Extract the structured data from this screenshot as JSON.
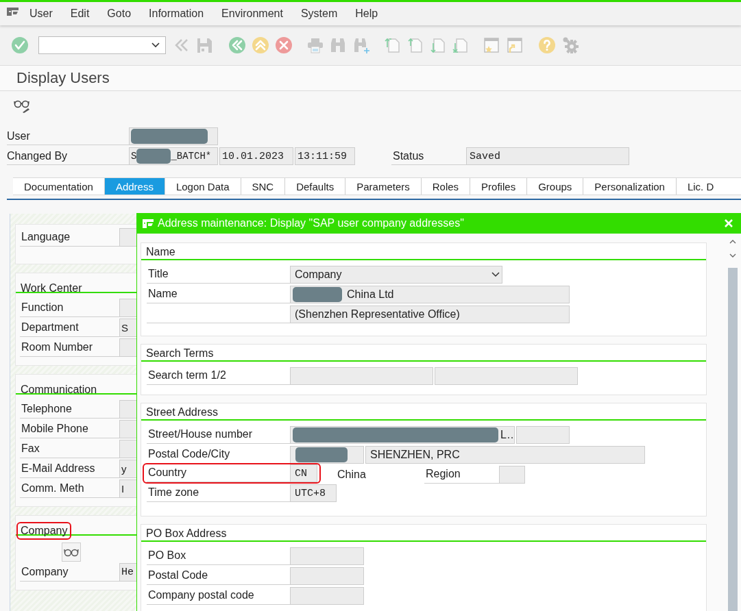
{
  "menu": [
    "User",
    "Edit",
    "Goto",
    "Information",
    "Environment",
    "System",
    "Help"
  ],
  "title": "Display Users",
  "header": {
    "rows": [
      {
        "label": "User",
        "fields": [
          {
            "kind": "user",
            "redacted": true
          }
        ]
      },
      {
        "label": "Changed By",
        "fields": [
          {
            "kind": "user",
            "prefix": "S",
            "redacted": true,
            "text": "_BATCH*"
          },
          {
            "kind": "date",
            "text": "10.01.2023"
          },
          {
            "kind": "time",
            "text": "13:11:59"
          }
        ]
      }
    ],
    "status": {
      "label": "Status",
      "value": "Saved"
    }
  },
  "tabs": [
    {
      "label": "Documentation",
      "selected": false
    },
    {
      "label": "Address",
      "selected": true
    },
    {
      "label": "Logon Data",
      "selected": false
    },
    {
      "label": "SNC",
      "selected": false
    },
    {
      "label": "Defaults",
      "selected": false
    },
    {
      "label": "Parameters",
      "selected": false
    },
    {
      "label": "Roles",
      "selected": false
    },
    {
      "label": "Profiles",
      "selected": false
    },
    {
      "label": "Groups",
      "selected": false
    },
    {
      "label": "Personalization",
      "selected": false
    },
    {
      "label": "Lic. D",
      "selected": false
    }
  ],
  "left_panel": {
    "groups": [
      {
        "rows": [
          {
            "label": "Language"
          }
        ]
      },
      {
        "title": "Work Center",
        "highlighted": false,
        "rows": [
          {
            "label": "Function"
          },
          {
            "label": "Department",
            "value": "S"
          },
          {
            "label": "Room Number"
          }
        ]
      },
      {
        "title": "Communication",
        "highlighted": false,
        "rows": [
          {
            "label": "Telephone"
          },
          {
            "label": "Mobile Phone"
          },
          {
            "label": "Fax"
          },
          {
            "label": "E-Mail Address",
            "value": "y"
          },
          {
            "label": "Comm. Meth",
            "value": "I"
          }
        ]
      },
      {
        "title": "Company",
        "highlighted": true,
        "display_button": true,
        "rows": [
          {
            "label": "Company",
            "value": "He",
            "mono": true
          }
        ]
      }
    ]
  },
  "dialog": {
    "title": "Address maintenance: Display \"SAP user company addresses\"",
    "groups": [
      {
        "title": "Name",
        "rows": [
          {
            "label": "Title",
            "fields": [
              {
                "kind": "dropdown",
                "text": "Company"
              }
            ]
          },
          {
            "label": "Name",
            "fields": [
              {
                "kind": "name",
                "redacted": true,
                "text": "China Ltd"
              }
            ]
          },
          {
            "fields": [
              {
                "kind": "name",
                "text": "(Shenzhen Representative Office)"
              }
            ]
          }
        ]
      },
      {
        "title": "Search Terms",
        "rows": [
          {
            "label": "Search term 1/2",
            "fields": [
              {
                "kind": "search"
              },
              {
                "kind": "search"
              }
            ]
          }
        ]
      },
      {
        "title": "Street Address",
        "rows": [
          {
            "label": "Street/House number",
            "fields": [
              {
                "kind": "street",
                "redacted": true,
                "text": "L…"
              },
              {
                "kind": "house"
              }
            ]
          },
          {
            "label": "Postal Code/City",
            "fields": [
              {
                "kind": "postal",
                "redacted": true
              },
              {
                "kind": "city",
                "text": "SHENZHEN, PRC"
              }
            ]
          },
          {
            "label": "Country",
            "highlighted": true,
            "fields": [
              {
                "kind": "country",
                "text": "CN"
              }
            ],
            "description": "China",
            "extra": {
              "label": "Region",
              "fields": [
                {
                  "kind": "region"
                }
              ]
            }
          },
          {
            "label": "Time zone",
            "highlighted": false,
            "fields": [
              {
                "kind": "timezone",
                "text": "UTC+8"
              }
            ]
          }
        ]
      },
      {
        "title": "PO Box Address",
        "rows": [
          {
            "label": "PO Box",
            "fields": [
              {
                "kind": "pobox"
              }
            ]
          },
          {
            "label": "Postal Code",
            "fields": [
              {
                "kind": "pobox"
              }
            ]
          },
          {
            "label": "Company postal code",
            "fields": [
              {
                "kind": "pobox"
              }
            ]
          }
        ]
      }
    ]
  }
}
